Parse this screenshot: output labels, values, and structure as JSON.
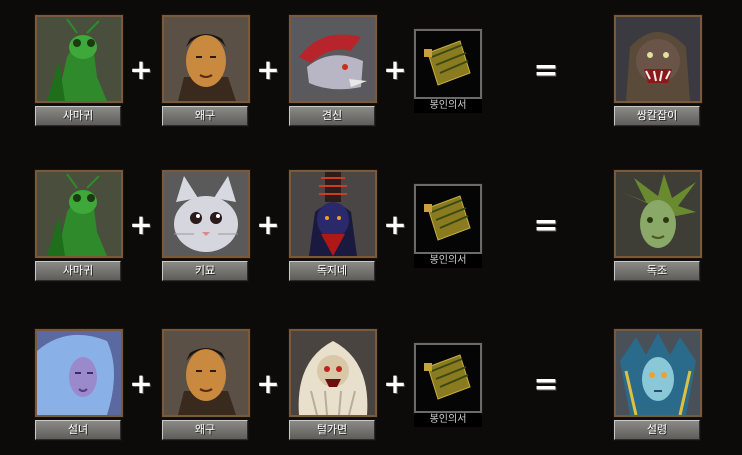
{
  "recipes": [
    {
      "ingredients": [
        "사마귀",
        "왜구",
        "견신"
      ],
      "scroll": "봉인의서",
      "result": "쌍칼잡이"
    },
    {
      "ingredients": [
        "사마귀",
        "키묘",
        "독지네"
      ],
      "scroll": "봉인의서",
      "result": "독조"
    },
    {
      "ingredients": [
        "설녀",
        "왜구",
        "털가면"
      ],
      "scroll": "봉인의서",
      "result": "설령"
    }
  ],
  "symbols": {
    "plus": "+",
    "equals": "="
  },
  "icons": {
    "mantis": "mantis-portrait-icon",
    "wokou": "wokou-portrait-icon",
    "dog_spirit": "dog-spirit-portrait-icon",
    "twin_blade": "twin-blade-portrait-icon",
    "cat": "cat-portrait-icon",
    "centipede": "centipede-portrait-icon",
    "poison_bird": "poison-bird-portrait-icon",
    "snow_woman": "snow-woman-portrait-icon",
    "hair_mask": "hair-mask-portrait-icon",
    "snow_spirit": "snow-spirit-portrait-icon",
    "scroll": "sealing-scroll-icon"
  }
}
